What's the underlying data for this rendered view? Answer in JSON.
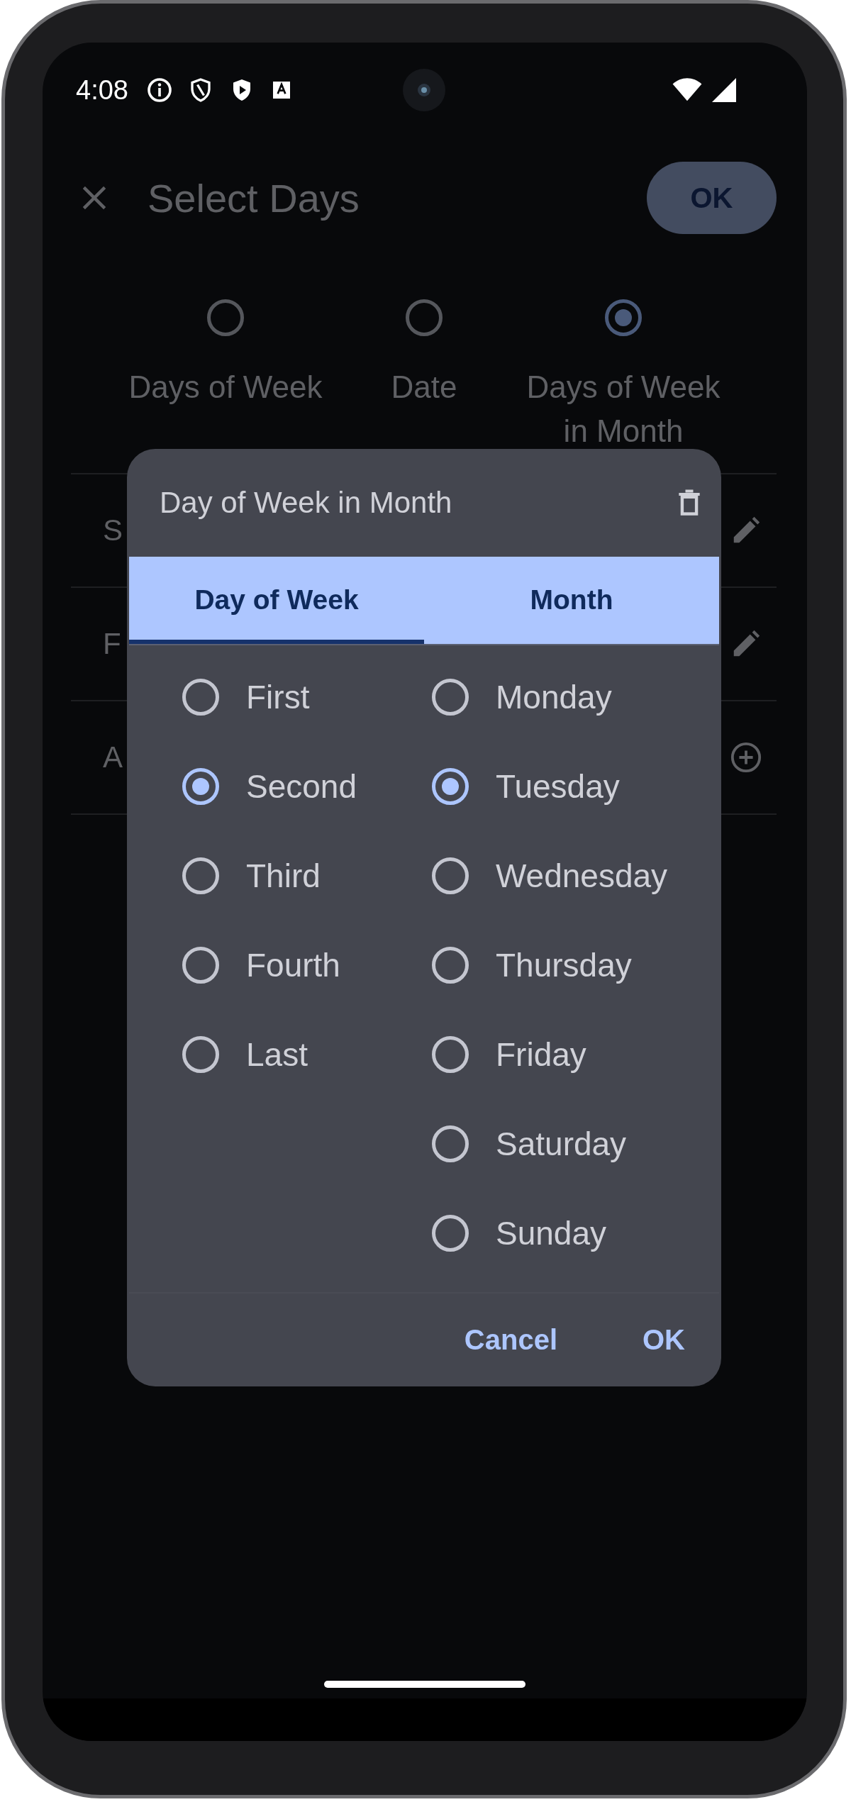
{
  "status_bar": {
    "time": "4:08"
  },
  "app_bar": {
    "title": "Select Days",
    "ok_label": "OK"
  },
  "mode_options": [
    {
      "label": "Days of Week",
      "selected": false
    },
    {
      "label": "Date",
      "selected": false
    },
    {
      "label": "Days of Week in Month",
      "selected": true
    }
  ],
  "rows": [
    {
      "label": "S",
      "kind": "edit"
    },
    {
      "label": "F",
      "kind": "edit"
    },
    {
      "label": "A",
      "kind": "add"
    }
  ],
  "dialog": {
    "title": "Day of Week in Month",
    "tabs": [
      {
        "label": "Day of Week",
        "selected": true
      },
      {
        "label": "Month",
        "selected": false
      }
    ],
    "week_options": [
      {
        "label": "First",
        "selected": false
      },
      {
        "label": "Second",
        "selected": true
      },
      {
        "label": "Third",
        "selected": false
      },
      {
        "label": "Fourth",
        "selected": false
      },
      {
        "label": "Last",
        "selected": false
      }
    ],
    "day_options": [
      {
        "label": "Monday",
        "selected": false
      },
      {
        "label": "Tuesday",
        "selected": true
      },
      {
        "label": "Wednesday",
        "selected": false
      },
      {
        "label": "Thursday",
        "selected": false
      },
      {
        "label": "Friday",
        "selected": false
      },
      {
        "label": "Saturday",
        "selected": false
      },
      {
        "label": "Sunday",
        "selected": false
      }
    ],
    "buttons": [
      "Cancel",
      "OK"
    ]
  }
}
